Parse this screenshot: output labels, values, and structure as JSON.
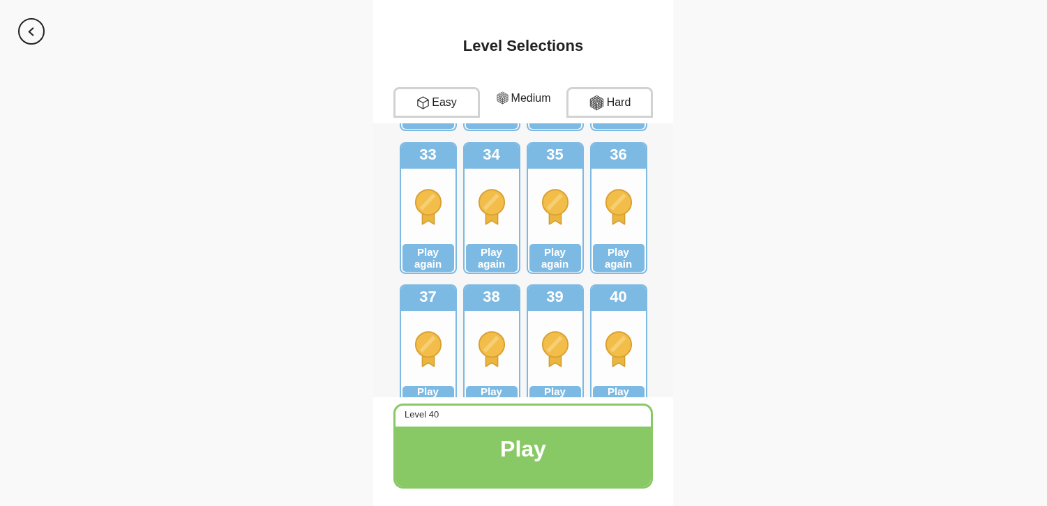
{
  "title": "Level Selections",
  "tabs": [
    {
      "label": "Easy",
      "kind": "easy",
      "selected": false
    },
    {
      "label": "Medium",
      "kind": "medium",
      "selected": true
    },
    {
      "label": "Hard",
      "kind": "hard",
      "selected": false
    }
  ],
  "levels": {
    "rows": [
      {
        "cut_off": false,
        "cards": [
          {
            "number": "33",
            "completed": true,
            "button": "Play again"
          },
          {
            "number": "34",
            "completed": true,
            "button": "Play again"
          },
          {
            "number": "35",
            "completed": true,
            "button": "Play again"
          },
          {
            "number": "36",
            "completed": true,
            "button": "Play again"
          }
        ]
      },
      {
        "cut_off": true,
        "cards": [
          {
            "number": "37",
            "completed": true,
            "button": "Play"
          },
          {
            "number": "38",
            "completed": true,
            "button": "Play"
          },
          {
            "number": "39",
            "completed": true,
            "button": "Play"
          },
          {
            "number": "40",
            "completed": true,
            "button": "Play"
          }
        ]
      }
    ]
  },
  "footer": {
    "level_label": "Level 40",
    "play_button": "Play"
  }
}
